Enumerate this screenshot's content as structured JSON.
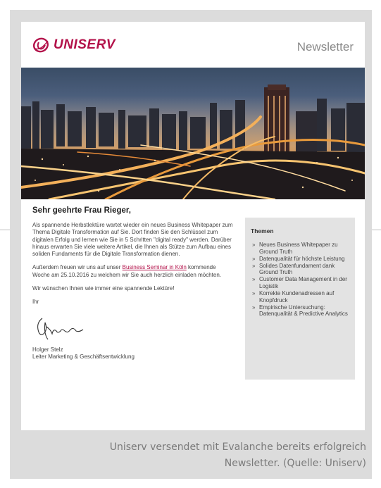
{
  "brand": {
    "name": "UNISERV",
    "color": "#b3124a"
  },
  "header": {
    "newsletter_label": "Newsletter"
  },
  "letter": {
    "salutation": "Sehr geehrte Frau Rieger,",
    "paragraph_1": "Als spannende Herbstlektüre wartet wieder ein neues Business Whitepaper zum Thema Digitale Transformation auf Sie. Dort finden Sie den Schlüssel zum digitalen Erfolg und lernen wie Sie in 5 Schritten \"digital ready\" werden. Darüber hinaus erwarten Sie viele weitere Artikel, die Ihnen als Stütze zum Aufbau eines soliden Fundaments für die Digitale Transformation dienen.",
    "paragraph_2_before": "Außerdem freuen wir uns auf unser ",
    "paragraph_2_link": "Business Seminar in Köln",
    "paragraph_2_after": " kommende Woche am 25.10.2016 zu welchem wir Sie auch herzlich einladen möchten.",
    "paragraph_3": "Wir wünschen Ihnen wie immer eine spannende Lektüre!",
    "closing": "Ihr",
    "sender_name": "Holger Stelz",
    "sender_title": "Leiter Marketing & Geschäftsentwicklung"
  },
  "themen": {
    "title": "Themen",
    "items": [
      "Neues Business Whitepaper zu Ground Truth",
      "Datenqualität für höchste Leistung",
      "Solides Datenfundament dank Ground Truth",
      "Customer Data Management in der Logistik",
      "Korrekte Kundenadressen auf Knopfdruck",
      "Empirische Untersuchung: Datenqualität & Predictive Analytics"
    ]
  },
  "caption": {
    "line_1": "Uniserv versendet mit Evalanche bereits erfolgreich",
    "line_2": "Newsletter.  (Quelle: Uniserv)"
  }
}
